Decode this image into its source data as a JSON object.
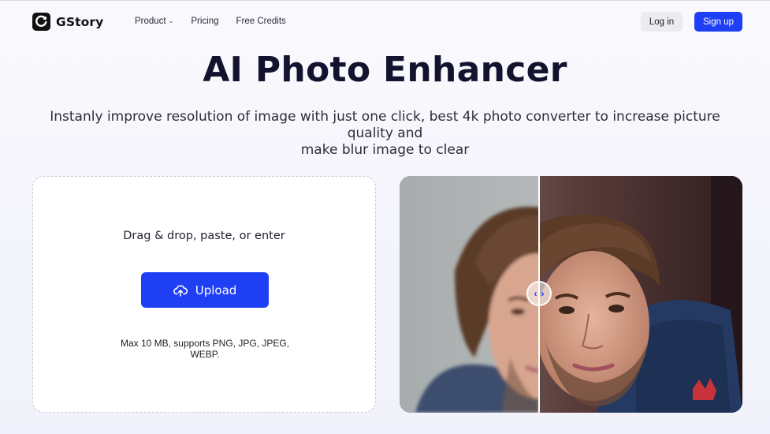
{
  "brand": {
    "name": "GStory"
  },
  "nav": {
    "items": [
      {
        "label": "Product",
        "has_dropdown": true
      },
      {
        "label": "Pricing",
        "has_dropdown": false
      },
      {
        "label": "Free Credits",
        "has_dropdown": false
      }
    ],
    "login_label": "Log in",
    "signup_label": "Sign up"
  },
  "hero": {
    "title": "AI Photo Enhancer",
    "subtitle_line1": "Instanly improve resolution of image with just one click, best 4k photo converter to increase picture quality and",
    "subtitle_line2": "make blur image to clear"
  },
  "upload": {
    "prompt": "Drag & drop, paste, or enter",
    "button_label": "Upload",
    "note_line1": "Max 10 MB, supports PNG, JPG, JPEG,",
    "note_line2": "WEBP."
  },
  "compare": {
    "left_state": "blurry original",
    "right_state": "enhanced",
    "handle_left_icon": "chevron-left-icon",
    "handle_right_icon": "chevron-right-icon"
  },
  "colors": {
    "accent": "#1f3ff5",
    "title": "#13132f",
    "background": "#f4f5fc"
  }
}
